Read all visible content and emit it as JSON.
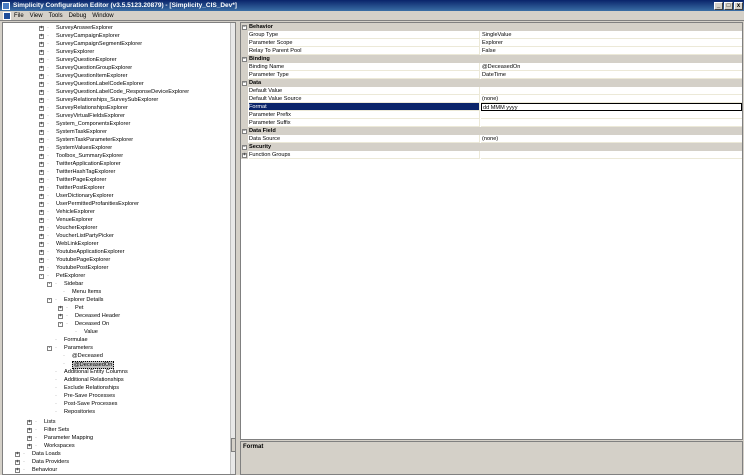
{
  "window": {
    "title": "Simplicity Configuration Editor (v3.5.5123.20879) - [Simplicity_CIS_Dev*]",
    "minimize": "_",
    "maximize": "□",
    "close": "x"
  },
  "menu": [
    "File",
    "View",
    "Tools",
    "Debug",
    "Window"
  ],
  "tree": [
    {
      "label": "SurveyAnswerExplorer",
      "indent": 36,
      "exp": "+"
    },
    {
      "label": "SurveyCampaignExplorer",
      "indent": 36,
      "exp": "+"
    },
    {
      "label": "SurveyCampaignSegmentExplorer",
      "indent": 36,
      "exp": "+"
    },
    {
      "label": "SurveyExplorer",
      "indent": 36,
      "exp": "+"
    },
    {
      "label": "SurveyQuestionExplorer",
      "indent": 36,
      "exp": "+"
    },
    {
      "label": "SurveyQuestionGroupExplorer",
      "indent": 36,
      "exp": "+"
    },
    {
      "label": "SurveyQuestionItemExplorer",
      "indent": 36,
      "exp": "+"
    },
    {
      "label": "SurveyQuestionLabelCodeExplorer",
      "indent": 36,
      "exp": "+"
    },
    {
      "label": "SurveyQuestionLabelCode_ResponseDeviceExplorer",
      "indent": 36,
      "exp": "+"
    },
    {
      "label": "SurveyRelationships_SurveySubExplorer",
      "indent": 36,
      "exp": "+"
    },
    {
      "label": "SurveyRelationshipsExplorer",
      "indent": 36,
      "exp": "+"
    },
    {
      "label": "SurveyVirtualFieldsExplorer",
      "indent": 36,
      "exp": "+"
    },
    {
      "label": "System_ComponentsExplorer",
      "indent": 36,
      "exp": "+"
    },
    {
      "label": "SystemTaskExplorer",
      "indent": 36,
      "exp": "+"
    },
    {
      "label": "SystemTaskParameterExplorer",
      "indent": 36,
      "exp": "+"
    },
    {
      "label": "SystemValuesExplorer",
      "indent": 36,
      "exp": "+"
    },
    {
      "label": "Toolbox_SummaryExplorer",
      "indent": 36,
      "exp": "+"
    },
    {
      "label": "TwitterApplicationExplorer",
      "indent": 36,
      "exp": "+"
    },
    {
      "label": "TwitterHashTagExplorer",
      "indent": 36,
      "exp": "+"
    },
    {
      "label": "TwitterPageExplorer",
      "indent": 36,
      "exp": "+"
    },
    {
      "label": "TwitterPostExplorer",
      "indent": 36,
      "exp": "+"
    },
    {
      "label": "UserDictionaryExplorer",
      "indent": 36,
      "exp": "+"
    },
    {
      "label": "UserPermittedProfanitiesExplorer",
      "indent": 36,
      "exp": "+"
    },
    {
      "label": "VehicleExplorer",
      "indent": 36,
      "exp": "+"
    },
    {
      "label": "VenueExplorer",
      "indent": 36,
      "exp": "+"
    },
    {
      "label": "VoucherExplorer",
      "indent": 36,
      "exp": "+"
    },
    {
      "label": "VoucherListPartyPicker",
      "indent": 36,
      "exp": "+"
    },
    {
      "label": "WebLinkExplorer",
      "indent": 36,
      "exp": "+"
    },
    {
      "label": "YoutubeApplicationExplorer",
      "indent": 36,
      "exp": "+"
    },
    {
      "label": "YoutubePageExplorer",
      "indent": 36,
      "exp": "+"
    },
    {
      "label": "YoutubePostExplorer",
      "indent": 36,
      "exp": "+"
    },
    {
      "label": "PetExplorer",
      "indent": 36,
      "exp": "-"
    },
    {
      "label": "Sidebar",
      "indent": 44,
      "exp": "-"
    },
    {
      "label": "Menu Items",
      "indent": 52,
      "exp": ""
    },
    {
      "label": "Explorer Details",
      "indent": 44,
      "exp": "-"
    },
    {
      "label": "Pet",
      "indent": 55,
      "exp": "+"
    },
    {
      "label": "Deceased Header",
      "indent": 55,
      "exp": "+"
    },
    {
      "label": "Deceased On",
      "indent": 55,
      "exp": "-"
    },
    {
      "label": "Value",
      "indent": 64,
      "exp": ""
    },
    {
      "label": "Formulae",
      "indent": 44,
      "exp": ""
    },
    {
      "label": "Parameters",
      "indent": 44,
      "exp": "-"
    },
    {
      "label": "@Deceased",
      "indent": 52,
      "exp": ""
    },
    {
      "label": "@DeceasedOn",
      "indent": 52,
      "exp": "",
      "selected": true
    },
    {
      "label": "Additional Entity Columns",
      "indent": 44,
      "exp": ""
    },
    {
      "label": "Additional Relationships",
      "indent": 44,
      "exp": ""
    },
    {
      "label": "Exclude Relationships",
      "indent": 44,
      "exp": ""
    },
    {
      "label": "Pre-Save Processes",
      "indent": 44,
      "exp": ""
    },
    {
      "label": "Post-Save Processes",
      "indent": 44,
      "exp": ""
    },
    {
      "label": "Repositories",
      "indent": 44,
      "exp": ""
    },
    {
      "label": "",
      "indent": 0,
      "exp": "",
      "spacer": true
    },
    {
      "label": "Lists",
      "indent": 24,
      "exp": "+"
    },
    {
      "label": "Filter Sets",
      "indent": 24,
      "exp": "+"
    },
    {
      "label": "Parameter Mapping",
      "indent": 24,
      "exp": "+"
    },
    {
      "label": "Workspaces",
      "indent": 24,
      "exp": "+"
    },
    {
      "label": "Data Loads",
      "indent": 12,
      "exp": "+"
    },
    {
      "label": "Data Providers",
      "indent": 12,
      "exp": "+"
    },
    {
      "label": "Behaviour",
      "indent": 12,
      "exp": "+"
    }
  ],
  "properties": [
    {
      "cat": "Behavior"
    },
    {
      "name": "Group Type",
      "value": "SingleValue"
    },
    {
      "name": "Parameter Scope",
      "value": "Explorer"
    },
    {
      "name": "Relay To Parent Pool",
      "value": "False"
    },
    {
      "cat": "Binding"
    },
    {
      "name": "Binding Name",
      "value": "@DeceasedOn"
    },
    {
      "name": "Parameter Type",
      "value": "DateTime"
    },
    {
      "cat": "Data"
    },
    {
      "name": "Default Value",
      "value": ""
    },
    {
      "name": "Default Value Source",
      "value": "(none)"
    },
    {
      "name": "Format",
      "value": "dd MMM yyyy",
      "selected": true
    },
    {
      "name": "Parameter Prefix",
      "value": ""
    },
    {
      "name": "Parameter Suffix",
      "value": ""
    },
    {
      "cat": "Data Field"
    },
    {
      "name": "Data Source",
      "value": "(none)"
    },
    {
      "cat": "Security"
    },
    {
      "name": "Function Groups",
      "value": "",
      "expandable": true
    }
  ],
  "description": {
    "title": "Format"
  }
}
